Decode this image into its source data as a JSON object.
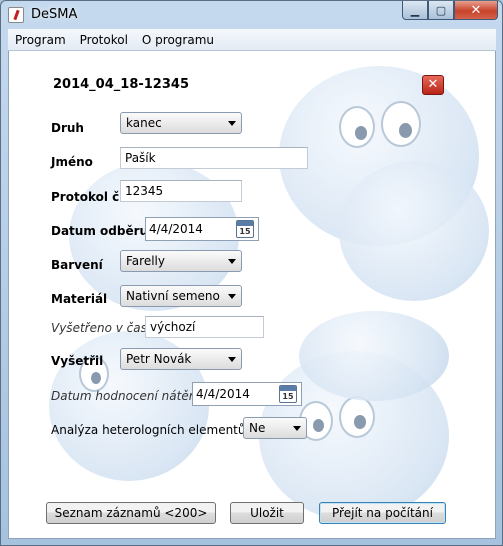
{
  "window": {
    "title": "DeSMA"
  },
  "menu": [
    {
      "label": "Program"
    },
    {
      "label": "Protokol"
    },
    {
      "label": "O programu"
    }
  ],
  "record": {
    "title": "2014_04_18-12345"
  },
  "form": {
    "druh": {
      "label": "Druh",
      "value": "kanec"
    },
    "jmeno": {
      "label": "Jméno",
      "value": "Pašík"
    },
    "protokol": {
      "label": "Protokol č.",
      "value": "12345"
    },
    "datum_odberu": {
      "label": "Datum odběru",
      "value": "4/4/2014",
      "icon_day": "15"
    },
    "barveni": {
      "label": "Barvení",
      "value": "Farelly"
    },
    "material": {
      "label": "Materiál",
      "value": "Nativní semeno"
    },
    "vysetreno": {
      "label": "Vyšetřeno v čase",
      "value": "výchozí"
    },
    "vysetril": {
      "label": "Vyšetřil",
      "value": "Petr Novák"
    },
    "datum_hodnoceni": {
      "label": "Datum hodnocení nátěru",
      "value": "4/4/2014",
      "icon_day": "15"
    },
    "analyza": {
      "label": "Analýza heterologních elementů",
      "value": "Ne"
    }
  },
  "buttons": {
    "seznam": "Seznam záznamů <200>",
    "ulozit": "Uložit",
    "prejit": "Přejít na počítání"
  },
  "icons": {
    "app": "app-icon",
    "minimize": "minimize-icon",
    "maximize": "maximize-icon",
    "close": "close-icon",
    "record_close": "close-x-icon",
    "calendar": "calendar-icon",
    "dropdown": "chevron-down-icon"
  },
  "colors": {
    "close_button": "#c8432c",
    "record_close": "#b82416",
    "window_chrome": "#a6c2de",
    "focused_button_border": "#3c7fb1"
  }
}
